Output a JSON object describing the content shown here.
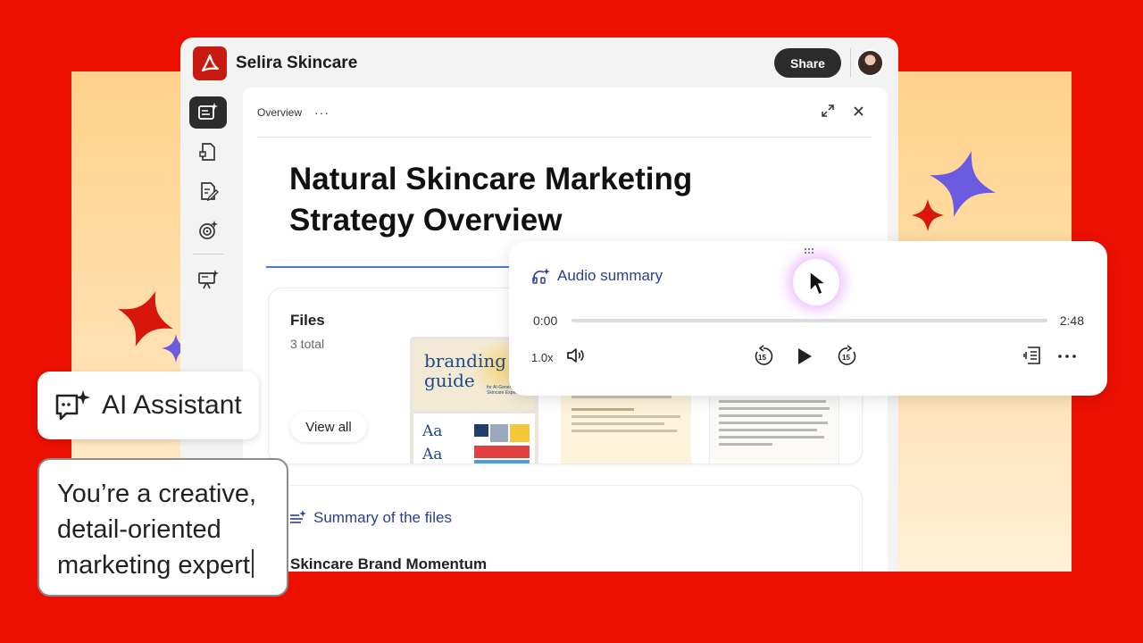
{
  "colors": {
    "brand_red": "#eb1000",
    "sparkle_purple": "#6a5be0",
    "heading_blue": "#2a3f8f"
  },
  "app": {
    "title": "Selira Skincare",
    "share_label": "Share",
    "rail_icons": [
      "ai-assistant-icon",
      "document-quote-icon",
      "document-edit-icon",
      "target-sparkle-icon",
      "presentation-sparkle-icon"
    ]
  },
  "panel": {
    "tab_label": "Overview",
    "more_label": "···",
    "doc_title": "Natural Skincare Marketing Strategy Overview"
  },
  "files": {
    "title": "Files",
    "count": "3 total",
    "view_all": "View all",
    "thumbs": [
      {
        "heading": "branding guide",
        "sub": "for AI-Generated Skincare Experiences"
      },
      {
        "heading": "1. Welcome & Agenda Overview",
        "sub": "2. Brand & Market Update"
      },
      {
        "heading": "Accessibility Notes"
      }
    ]
  },
  "summary": {
    "title": "Summary of the files",
    "subtitle": "Skincare Brand Momentum"
  },
  "audio": {
    "title": "Audio summary",
    "time_start": "0:00",
    "time_end": "2:48",
    "progress": 0.0,
    "speed": "1.0x",
    "skip_back_seconds": "15",
    "skip_forward_seconds": "15"
  },
  "ai_chip": {
    "label": "AI Assistant"
  },
  "prompt": {
    "line1": "You’re a creative,",
    "line2": "detail-oriented",
    "line3": "marketing expert"
  }
}
